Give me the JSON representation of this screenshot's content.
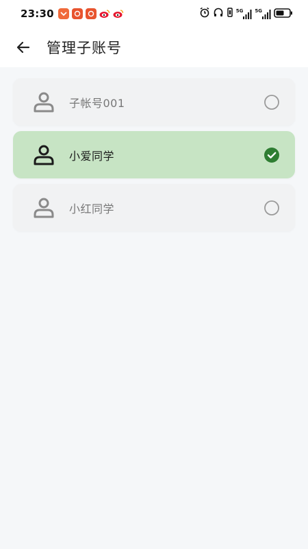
{
  "status_bar": {
    "time": "23:30",
    "notification_icons": [
      "app-notification-icon",
      "app-notification-icon",
      "app-notification-icon",
      "weibo-icon",
      "weibo-icon"
    ],
    "network_labels": [
      "5G",
      "5G"
    ]
  },
  "header": {
    "title": "管理子账号",
    "back_icon": "arrow-left-icon"
  },
  "accounts": [
    {
      "name": "子帐号001",
      "selected": false
    },
    {
      "name": "小爱同学",
      "selected": true
    },
    {
      "name": "小红同学",
      "selected": false
    }
  ],
  "colors": {
    "selected_card": "#c7e4c4",
    "unselected_card": "#f1f2f3",
    "check_green": "#2e7d32",
    "background": "#f5f7f9"
  }
}
